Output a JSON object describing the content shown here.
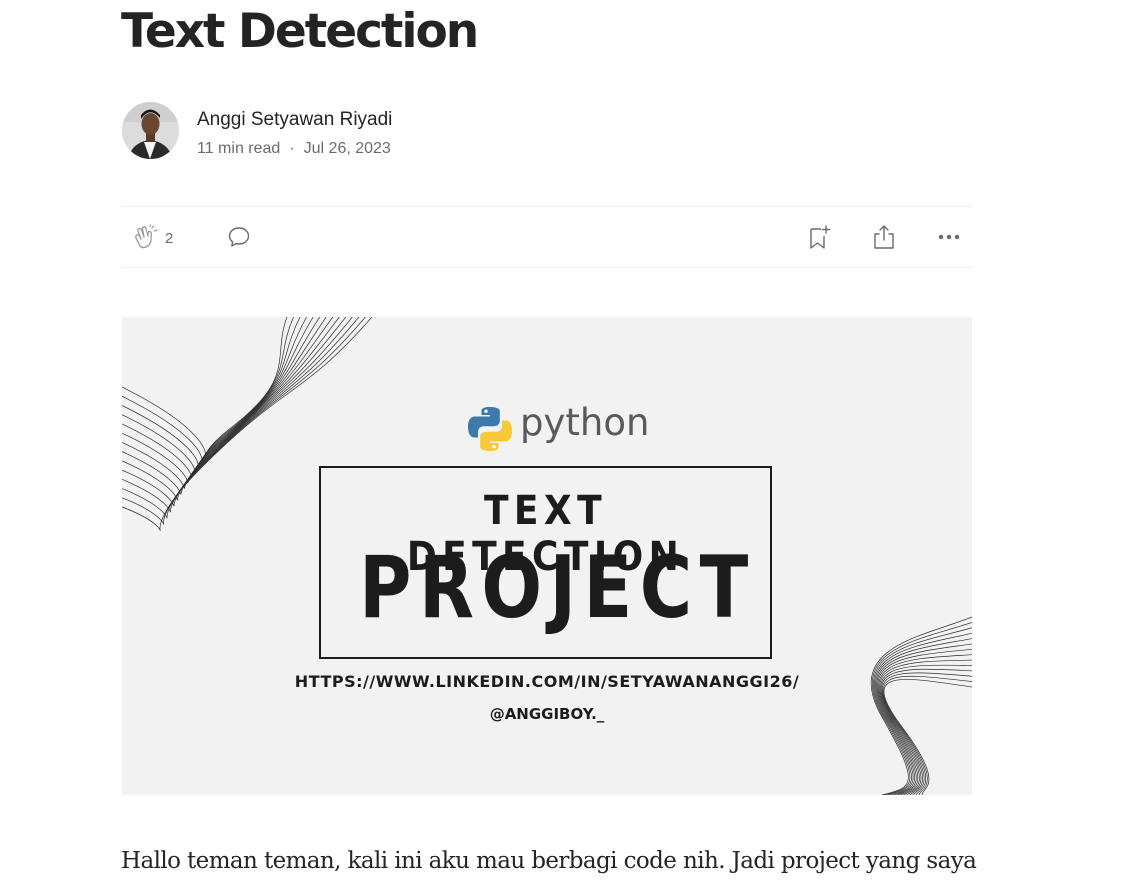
{
  "article": {
    "title": "Text Detection",
    "author": {
      "name": "Anggi Setyawan Riyadi",
      "read_time": "11 min read",
      "separator": "·",
      "date": "Jul 26, 2023"
    },
    "actions": {
      "clap_count": "2",
      "icons": [
        "clap-icon",
        "comment-icon",
        "bookmark-add-icon",
        "share-icon",
        "more-icon"
      ]
    },
    "hero": {
      "logo_text": "python",
      "box_title": "TEXT DETECTION",
      "box_subtitle": "PROJECT",
      "url": "HTTPS://WWW.LINKEDIN.COM/IN/SETYAWANANGGI26/",
      "handle": "@ANGGIBOY._"
    },
    "body_first_line": "Hallo teman teman, kali ini aku mau berbagi code nih. Jadi project yang saya"
  },
  "colors": {
    "text": "#242424",
    "muted": "#6b6b6b",
    "python_blue": "#3d79ab",
    "python_yellow": "#f5c93a"
  }
}
